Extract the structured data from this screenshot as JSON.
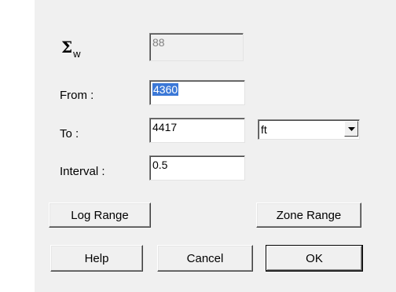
{
  "sigma_w": {
    "symbol": "Σ",
    "subscript": "w",
    "value": "88"
  },
  "from": {
    "label": "From :",
    "value": "4360"
  },
  "to": {
    "label": "To :",
    "value": "4417"
  },
  "units": {
    "selected": "ft",
    "arrow_icon": "chevron-down-icon"
  },
  "interval": {
    "label": "Interval :",
    "value": "0.5"
  },
  "buttons": {
    "log_range": "Log Range",
    "zone_range": "Zone Range",
    "help": "Help",
    "cancel": "Cancel",
    "ok": "OK"
  },
  "colors": {
    "dialog_background": "#f0f0f0",
    "selection_highlight": "#3b78d7"
  }
}
